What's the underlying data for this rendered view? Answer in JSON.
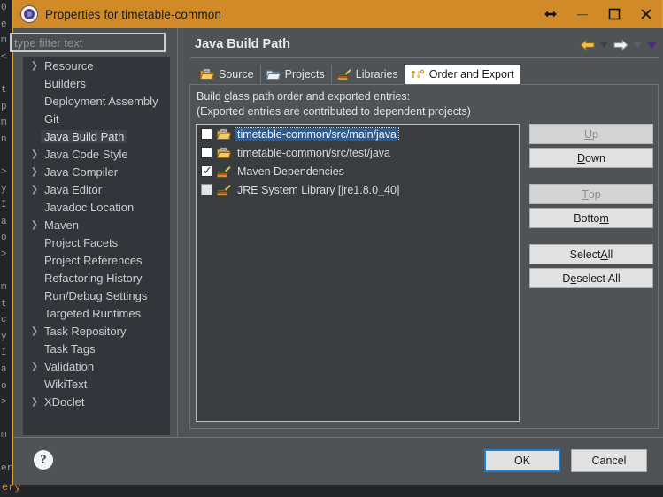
{
  "background": {
    "gutter_chars": "0\ne\nm\n<\n\nt\np\nm\nn\n\n>\ny\nI\na\no\n>\n\nm\nt\nc\ny\nI\na\no\n>\n\nm\n\ner",
    "bottom_text": "ery "
  },
  "window": {
    "title": "Properties for timetable-common",
    "title_icon": "properties-gear-icon",
    "controls": {
      "resize": "resize-horizontal-icon",
      "minimize": "minimize-icon",
      "maximize": "maximize-icon",
      "close": "close-icon"
    }
  },
  "filter": {
    "placeholder": "type filter text",
    "value": ""
  },
  "tree": {
    "items": [
      {
        "label": "Resource",
        "expandable": true,
        "selected": false
      },
      {
        "label": "Builders",
        "expandable": false,
        "selected": false
      },
      {
        "label": "Deployment Assembly",
        "expandable": false,
        "selected": false
      },
      {
        "label": "Git",
        "expandable": false,
        "selected": false
      },
      {
        "label": "Java Build Path",
        "expandable": false,
        "selected": true
      },
      {
        "label": "Java Code Style",
        "expandable": true,
        "selected": false
      },
      {
        "label": "Java Compiler",
        "expandable": true,
        "selected": false
      },
      {
        "label": "Java Editor",
        "expandable": true,
        "selected": false
      },
      {
        "label": "Javadoc Location",
        "expandable": false,
        "selected": false
      },
      {
        "label": "Maven",
        "expandable": true,
        "selected": false
      },
      {
        "label": "Project Facets",
        "expandable": false,
        "selected": false
      },
      {
        "label": "Project References",
        "expandable": false,
        "selected": false
      },
      {
        "label": "Refactoring History",
        "expandable": false,
        "selected": false
      },
      {
        "label": "Run/Debug Settings",
        "expandable": false,
        "selected": false
      },
      {
        "label": "Targeted Runtimes",
        "expandable": false,
        "selected": false
      },
      {
        "label": "Task Repository",
        "expandable": true,
        "selected": false
      },
      {
        "label": "Task Tags",
        "expandable": false,
        "selected": false
      },
      {
        "label": "Validation",
        "expandable": true,
        "selected": false
      },
      {
        "label": "WikiText",
        "expandable": false,
        "selected": false
      },
      {
        "label": "XDoclet",
        "expandable": true,
        "selected": false
      }
    ]
  },
  "page": {
    "title": "Java Build Path",
    "nav": {
      "back_icon": "arrow-left-icon",
      "back_menu_icon": "chevron-down-icon",
      "forward_icon": "arrow-right-icon",
      "forward_menu_icon": "chevron-down-icon",
      "more_icon": "chevron-down-icon"
    }
  },
  "tabs": [
    {
      "label": "Source",
      "icon": "source-folder-icon",
      "active": false
    },
    {
      "label": "Projects",
      "icon": "projects-folder-icon",
      "active": false
    },
    {
      "label": "Libraries",
      "icon": "libraries-books-icon",
      "active": false
    },
    {
      "label": "Order and Export",
      "icon": "order-export-arrows-icon",
      "active": true
    }
  ],
  "content": {
    "description_line1_pre": "Build ",
    "description_line1_mnemonic": "c",
    "description_line1_post": "lass path order and exported entries:",
    "description_line2": "(Exported entries are contributed to dependent projects)",
    "entries": [
      {
        "label": "timetable-common/src/main/java",
        "icon": "source-folder-icon",
        "checked": false,
        "selected": true,
        "dim": false
      },
      {
        "label": "timetable-common/src/test/java",
        "icon": "source-folder-icon",
        "checked": false,
        "selected": false,
        "dim": false
      },
      {
        "label": "Maven Dependencies",
        "icon": "libraries-books-icon",
        "checked": true,
        "selected": false,
        "dim": false
      },
      {
        "label": "JRE System Library [jre1.8.0_40]",
        "icon": "libraries-books-icon",
        "checked": false,
        "selected": false,
        "dim": true
      }
    ]
  },
  "side_buttons": [
    {
      "label_pre": "",
      "mnemonic": "U",
      "label_post": "p",
      "disabled": true,
      "name": "up-button"
    },
    {
      "label_pre": "",
      "mnemonic": "D",
      "label_post": "own",
      "disabled": false,
      "name": "down-button"
    },
    {
      "gap": true
    },
    {
      "label_pre": "",
      "mnemonic": "T",
      "label_post": "op",
      "disabled": true,
      "name": "top-button"
    },
    {
      "label_pre": "Botto",
      "mnemonic": "m",
      "label_post": "",
      "disabled": false,
      "name": "bottom-button"
    },
    {
      "gap": true
    },
    {
      "label_pre": "Select ",
      "mnemonic": "A",
      "label_post": "ll",
      "disabled": false,
      "name": "select-all-button"
    },
    {
      "label_pre": "D",
      "mnemonic": "e",
      "label_post": "select All",
      "disabled": false,
      "name": "deselect-all-button"
    }
  ],
  "footer": {
    "help_icon": "help-question-icon",
    "help_glyph": "?",
    "ok_label": "OK",
    "cancel_label": "Cancel"
  },
  "colors": {
    "titlebar": "#d08b28",
    "dialog_bg": "#4f5356",
    "tree_bg": "#32353a",
    "list_bg": "#3a3d40",
    "selection_blue": "#2e5a8c",
    "focus_blue": "#1e7fd4",
    "accent_orange": "#d9a23c"
  }
}
